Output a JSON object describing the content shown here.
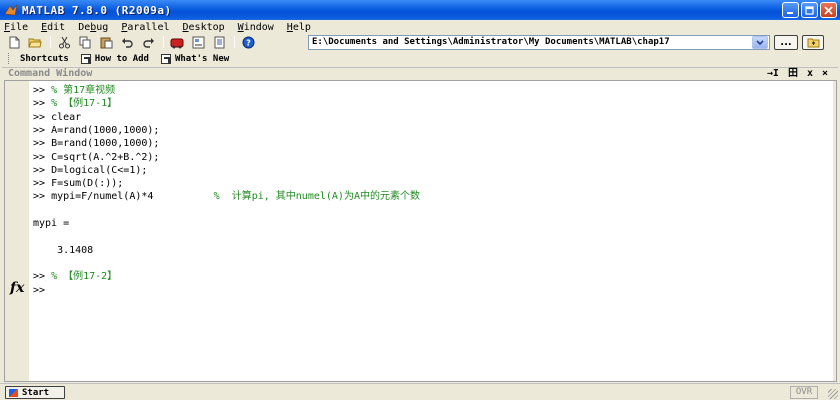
{
  "window": {
    "title": "MATLAB  7.8.0  (R2009a)",
    "accent": "#0a5ee0"
  },
  "menubar": {
    "items": [
      {
        "key": "F",
        "rest": "ile"
      },
      {
        "key": "E",
        "rest": "dit"
      },
      {
        "key": "",
        "pre": "De",
        "key2": "b",
        "rest": "ug"
      },
      {
        "key": "P",
        "rest": "arallel"
      },
      {
        "key": "D",
        "rest": "esktop"
      },
      {
        "key": "W",
        "rest": "indow"
      },
      {
        "key": "H",
        "rest": "elp"
      }
    ]
  },
  "toolbar": {
    "current_folder": "E:\\Documents and Settings\\Administrator\\My Documents\\MATLAB\\chap17",
    "browse_label": "...",
    "icons": [
      "new-file-icon",
      "open-folder-icon",
      "cut-icon",
      "copy-icon",
      "paste-icon",
      "undo-icon",
      "redo-icon",
      "simulink-icon",
      "guide-icon",
      "profiler-icon",
      "help-icon"
    ]
  },
  "shortcuts": {
    "label": "Shortcuts",
    "items": [
      "How to Add",
      "What's New"
    ]
  },
  "command_window": {
    "title": "Command Window",
    "controls": [
      "→I",
      "田",
      "x",
      "×"
    ],
    "lines": [
      {
        "prompt": ">> ",
        "text": "% 第17章视频",
        "comment": true
      },
      {
        "prompt": ">> ",
        "text": "% 【例17-1】",
        "comment": true
      },
      {
        "prompt": ">> ",
        "text": "clear",
        "comment": false
      },
      {
        "prompt": ">> ",
        "text": "A=rand(1000,1000);",
        "comment": false
      },
      {
        "prompt": ">> ",
        "text": "B=rand(1000,1000);",
        "comment": false
      },
      {
        "prompt": ">> ",
        "text": "C=sqrt(A.^2+B.^2);",
        "comment": false
      },
      {
        "prompt": ">> ",
        "text": "D=logical(C<=1);",
        "comment": false
      },
      {
        "prompt": ">> ",
        "text": "F=sum(D(:));",
        "comment": false
      },
      {
        "prompt": ">> ",
        "text": "mypi=F/numel(A)*4",
        "comment": false,
        "trailing_comment": "%  计算pi, 其中numel(A)为A中的元素个数"
      },
      {
        "prompt": "",
        "text": "",
        "comment": false
      },
      {
        "prompt": "",
        "text": "mypi =",
        "comment": false
      },
      {
        "prompt": "",
        "text": "",
        "comment": false
      },
      {
        "prompt": "",
        "text": "    3.1408",
        "comment": false
      },
      {
        "prompt": "",
        "text": "",
        "comment": false
      },
      {
        "prompt": ">> ",
        "text": "% 【例17-2】",
        "comment": true
      },
      {
        "prompt": ">> ",
        "text": "",
        "comment": false
      }
    ],
    "fx_label": "fx",
    "comment_color": "#228b22"
  },
  "statusbar": {
    "start_label": "Start",
    "ovr_label": "OVR"
  }
}
